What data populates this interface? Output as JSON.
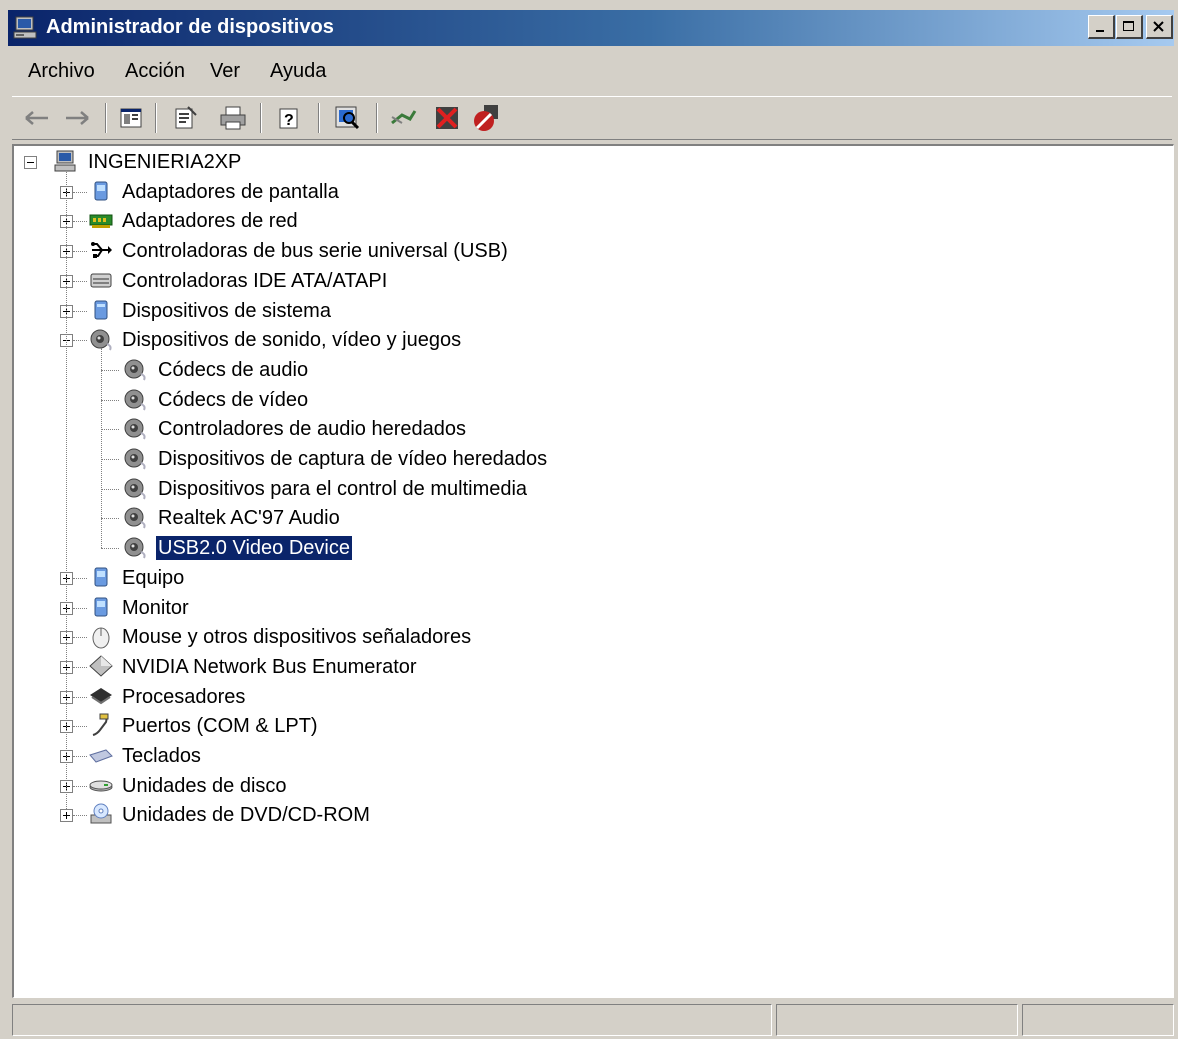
{
  "window": {
    "title": "Administrador de dispositivos",
    "controls": {
      "minimize": "_",
      "maximize": "□",
      "close": "×"
    },
    "icon": "computer-icon"
  },
  "menu": [
    "Archivo",
    "Acción",
    "Ver",
    "Ayuda"
  ],
  "toolbar_icons": [
    "back-arrow-icon",
    "forward-arrow-icon",
    "show-hide-tree-icon",
    "properties-icon",
    "print-icon",
    "help-icon",
    "scan-hardware-icon",
    "update-driver-icon",
    "uninstall-icon",
    "disable-icon"
  ],
  "tree": {
    "root": {
      "label": "INGENIERIA2XP",
      "icon": "computer-icon",
      "expanded": true
    },
    "categories": [
      {
        "label": "Adaptadores de pantalla",
        "icon": "display-adapter-icon"
      },
      {
        "label": "Adaptadores de red",
        "icon": "network-adapter-icon"
      },
      {
        "label": "Controladoras de bus serie universal (USB)",
        "icon": "usb-icon"
      },
      {
        "label": "Controladoras IDE ATA/ATAPI",
        "icon": "ide-controller-icon"
      },
      {
        "label": "Dispositivos de sistema",
        "icon": "system-device-icon"
      },
      {
        "label": "Dispositivos de sonido, vídeo y juegos",
        "icon": "sound-icon",
        "expanded": true,
        "children": [
          "Códecs de audio",
          "Códecs de vídeo",
          "Controladores de audio heredados",
          "Dispositivos de captura de vídeo heredados",
          "Dispositivos para el control de multimedia",
          "Realtek AC'97 Audio",
          "USB2.0 Video Device"
        ],
        "selected_child": "USB2.0 Video Device"
      },
      {
        "label": "Equipo",
        "icon": "computer-monitor-icon"
      },
      {
        "label": "Monitor",
        "icon": "monitor-icon"
      },
      {
        "label": "Mouse y otros dispositivos señaladores",
        "icon": "mouse-icon"
      },
      {
        "label": "NVIDIA Network Bus Enumerator",
        "icon": "diamond-icon"
      },
      {
        "label": "Procesadores",
        "icon": "processor-icon"
      },
      {
        "label": "Puertos (COM & LPT)",
        "icon": "port-icon"
      },
      {
        "label": "Teclados",
        "icon": "keyboard-icon"
      },
      {
        "label": "Unidades de disco",
        "icon": "disk-drive-icon"
      },
      {
        "label": "Unidades de DVD/CD-ROM",
        "icon": "dvd-drive-icon"
      }
    ]
  },
  "colors": {
    "titlebar_start": "#0a246a",
    "titlebar_end": "#a6caf0",
    "selection": "#0a246a",
    "window_bg": "#d4d0c8"
  }
}
